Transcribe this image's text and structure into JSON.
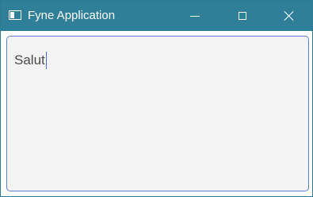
{
  "window": {
    "title": "Fyne Application",
    "controls": {
      "minimize_icon": "minimize-icon",
      "maximize_icon": "maximize-icon",
      "close_icon": "close-icon"
    }
  },
  "editor": {
    "value": "Salut",
    "focused": true
  },
  "colors": {
    "titlebar": "#2f7f98",
    "text_area_background": "#f3f3f3",
    "text_area_border": "#5b7fd0",
    "text": "#4a4a4a",
    "cursor": "#4a6fca"
  }
}
